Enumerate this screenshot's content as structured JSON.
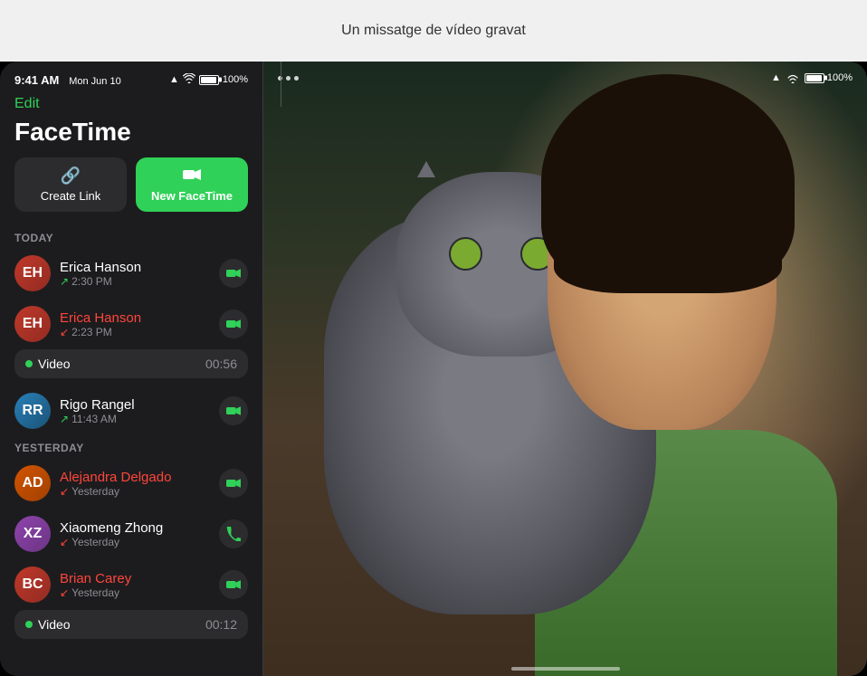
{
  "annotation": {
    "text": "Un missatge de vídeo gravat"
  },
  "status_bar": {
    "time": "9:41 AM",
    "date": "Mon Jun 10",
    "battery": "100%",
    "wifi": true,
    "signal": true
  },
  "header": {
    "edit_label": "Edit",
    "title": "FaceTime"
  },
  "buttons": {
    "create_link_label": "Create Link",
    "new_facetime_label": "New FaceTime",
    "create_link_icon": "🔗",
    "new_facetime_icon": "📹"
  },
  "sections": {
    "today_label": "TODAY",
    "yesterday_label": "YESTERDAY"
  },
  "contacts_today": [
    {
      "name": "Erica Hanson",
      "time": "2:30 PM",
      "type": "video",
      "missed": false,
      "initials": "EH",
      "color_class": "av-erica"
    },
    {
      "name": "Erica Hanson",
      "time": "2:23 PM",
      "type": "video",
      "missed": true,
      "initials": "EH",
      "color_class": "av-erica",
      "has_video_message": true,
      "video_label": "Video",
      "video_duration": "00:56"
    },
    {
      "name": "Rigo Rangel",
      "time": "11:43 AM",
      "type": "video",
      "missed": false,
      "initials": "RR",
      "color_class": "av-rigo"
    }
  ],
  "contacts_yesterday": [
    {
      "name": "Alejandra Delgado",
      "time": "Yesterday",
      "type": "video",
      "missed": true,
      "initials": "AD",
      "color_class": "av-alejandra"
    },
    {
      "name": "Xiaomeng Zhong",
      "time": "Yesterday",
      "type": "phone",
      "missed": true,
      "initials": "XZ",
      "color_class": "av-xiaomeng"
    },
    {
      "name": "Brian Carey",
      "time": "Yesterday",
      "type": "video",
      "missed": true,
      "initials": "BC",
      "color_class": "av-brian",
      "has_video_message": true,
      "video_label": "Video",
      "video_duration": "00:12"
    }
  ]
}
